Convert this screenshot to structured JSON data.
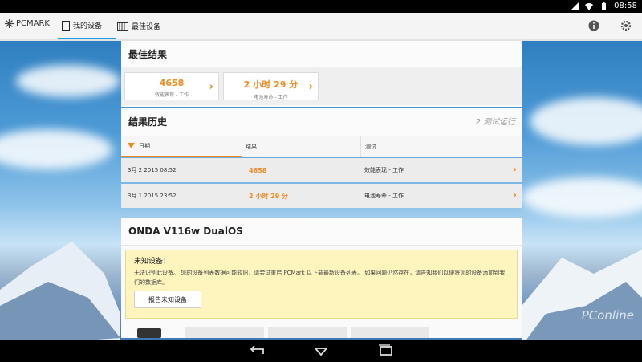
{
  "statusbar": {
    "time": "08:58"
  },
  "appbar": {
    "logo": "PCMARK",
    "tabs": [
      {
        "label": "我的设备"
      },
      {
        "label": "最佳设备"
      }
    ]
  },
  "best": {
    "title": "最佳结果",
    "cards": [
      {
        "value": "4658",
        "sub": "效能表现 - 工作"
      },
      {
        "value": "2 小时 29 分",
        "sub": "电池寿命 - 工作"
      }
    ]
  },
  "history": {
    "title": "结果历史",
    "runs": "2 测试运行",
    "columns": [
      "日期",
      "结果",
      "测试"
    ],
    "rows": [
      {
        "date": "3月 2 2015 08:52",
        "result": "4658",
        "test": "效能表现 - 工作"
      },
      {
        "date": "3月 1 2015 23:52",
        "result": "2 小时 29 分",
        "test": "电池寿命 - 工作"
      }
    ]
  },
  "device": {
    "name": "ONDA V116w DualOS",
    "warning_title": "未知设备！",
    "warning_text": "无法识别此设备。 您的设备列表数据可能较旧，请尝试重启 PCMark 以下载最新设备列表。 如果问题仍然存在，请告知我们以便将您的设备添加到我们的数据库。",
    "report_button": "报告未知设备"
  },
  "watermark": "PConline",
  "colors": {
    "accent": "#f28a1c",
    "tab_underline": "#1f9be0"
  }
}
